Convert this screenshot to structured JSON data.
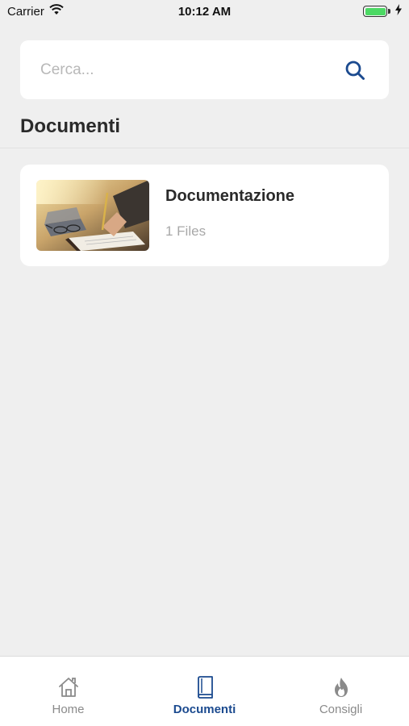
{
  "status_bar": {
    "carrier": "Carrier",
    "time": "10:12 AM",
    "battery_level": 1.0
  },
  "search": {
    "placeholder": "Cerca...",
    "icon": "search-icon"
  },
  "section": {
    "title": "Documenti"
  },
  "documents": [
    {
      "title": "Documentazione",
      "count": "1 Files",
      "thumbnail": "writing-at-desk-photo"
    }
  ],
  "tab_bar": {
    "tabs": [
      {
        "label": "Home",
        "icon": "home-icon",
        "active": false
      },
      {
        "label": "Documenti",
        "icon": "book-icon",
        "active": true
      },
      {
        "label": "Consigli",
        "icon": "flame-icon",
        "active": false
      }
    ]
  },
  "colors": {
    "accent": "#1b4a8f",
    "background": "#efefef",
    "card": "#ffffff",
    "inactive": "#8a8a8a"
  }
}
